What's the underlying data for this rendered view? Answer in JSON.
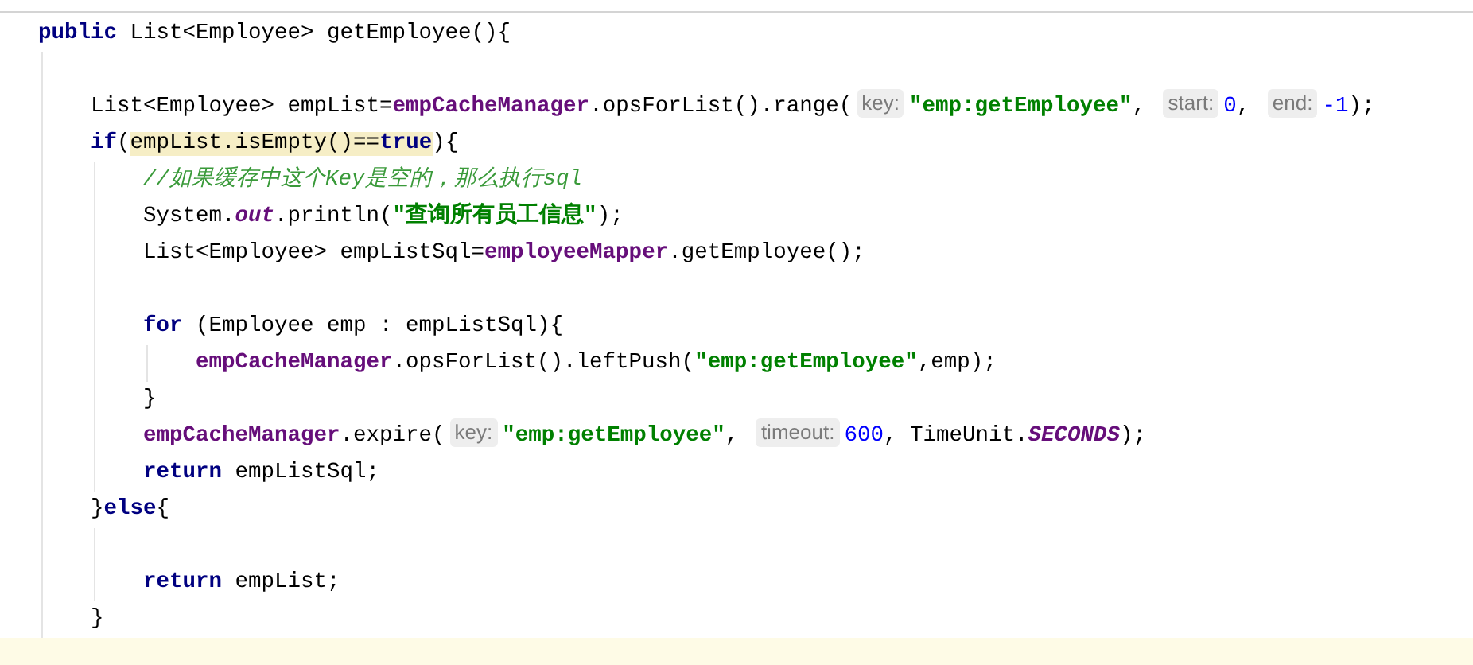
{
  "editor": {
    "lines": [
      {
        "current": false,
        "tokens": [
          {
            "kind": "keyword",
            "text": "public",
            "marked": false
          },
          {
            "kind": "plain",
            "text": " List<Employee> getEmployee(){",
            "marked": false
          }
        ],
        "children": [
          {
            "current": false
          },
          {
            "current": false,
            "tokens": [
              {
                "kind": "plain",
                "text": "List<Employee> empList=",
                "marked": false
              },
              {
                "kind": "field",
                "text": "empCacheManager",
                "marked": false
              },
              {
                "kind": "plain",
                "text": ".opsForList().range(",
                "marked": false
              },
              {
                "kind": "hint",
                "text": "key:",
                "marked": false
              },
              {
                "kind": "string",
                "text": "\"emp:getEmployee\"",
                "marked": false
              },
              {
                "kind": "plain",
                "text": ", ",
                "marked": false
              },
              {
                "kind": "hint",
                "text": "start:",
                "marked": false
              },
              {
                "kind": "number",
                "text": "0",
                "marked": false
              },
              {
                "kind": "plain",
                "text": ", ",
                "marked": false
              },
              {
                "kind": "hint",
                "text": "end:",
                "marked": false
              },
              {
                "kind": "number",
                "text": "-1",
                "marked": false
              },
              {
                "kind": "plain",
                "text": ");",
                "marked": false
              }
            ]
          },
          {
            "current": false,
            "tokens": [
              {
                "kind": "keyword",
                "text": "if",
                "marked": false
              },
              {
                "kind": "plain",
                "text": "(",
                "marked": false
              },
              {
                "kind": "plain",
                "text": "empList.isEmpty()==",
                "marked": true
              },
              {
                "kind": "keyword",
                "text": "true",
                "marked": true
              },
              {
                "kind": "plain",
                "text": "){",
                "marked": false
              }
            ],
            "children": [
              {
                "current": false,
                "tokens": [
                  {
                    "kind": "comment",
                    "text": "//如果缓存中这个Key是空的，那么执行sql",
                    "marked": false
                  }
                ]
              },
              {
                "current": false,
                "tokens": [
                  {
                    "kind": "plain",
                    "text": "System.",
                    "marked": false
                  },
                  {
                    "kind": "static",
                    "text": "out",
                    "marked": false
                  },
                  {
                    "kind": "plain",
                    "text": ".println(",
                    "marked": false
                  },
                  {
                    "kind": "string",
                    "text": "\"查询所有员工信息\"",
                    "marked": false
                  },
                  {
                    "kind": "plain",
                    "text": ");",
                    "marked": false
                  }
                ]
              },
              {
                "current": false,
                "tokens": [
                  {
                    "kind": "plain",
                    "text": "List<Employee> empListSql=",
                    "marked": false
                  },
                  {
                    "kind": "field",
                    "text": "employeeMapper",
                    "marked": false
                  },
                  {
                    "kind": "plain",
                    "text": ".getEmployee();",
                    "marked": false
                  }
                ]
              },
              {
                "current": false
              },
              {
                "current": false,
                "tokens": [
                  {
                    "kind": "keyword",
                    "text": "for",
                    "marked": false
                  },
                  {
                    "kind": "plain",
                    "text": " (Employee emp : empListSql){",
                    "marked": false
                  }
                ],
                "children": [
                  {
                    "current": false,
                    "tokens": [
                      {
                        "kind": "field",
                        "text": "empCacheManager",
                        "marked": false
                      },
                      {
                        "kind": "plain",
                        "text": ".opsForList().leftPush(",
                        "marked": false
                      },
                      {
                        "kind": "string",
                        "text": "\"emp:getEmployee\"",
                        "marked": false
                      },
                      {
                        "kind": "plain",
                        "text": ",emp);",
                        "marked": false
                      }
                    ]
                  }
                ]
              },
              {
                "current": false,
                "tokens": [
                  {
                    "kind": "plain",
                    "text": "}",
                    "marked": false
                  }
                ]
              },
              {
                "current": false,
                "tokens": [
                  {
                    "kind": "field",
                    "text": "empCacheManager",
                    "marked": false
                  },
                  {
                    "kind": "plain",
                    "text": ".expire(",
                    "marked": false
                  },
                  {
                    "kind": "hint",
                    "text": "key:",
                    "marked": false
                  },
                  {
                    "kind": "string",
                    "text": "\"emp:getEmployee\"",
                    "marked": false
                  },
                  {
                    "kind": "plain",
                    "text": ", ",
                    "marked": false
                  },
                  {
                    "kind": "hint",
                    "text": "timeout:",
                    "marked": false
                  },
                  {
                    "kind": "number",
                    "text": "600",
                    "marked": false
                  },
                  {
                    "kind": "plain",
                    "text": ", TimeUnit.",
                    "marked": false
                  },
                  {
                    "kind": "static",
                    "text": "SECONDS",
                    "marked": false
                  },
                  {
                    "kind": "plain",
                    "text": ");",
                    "marked": false
                  }
                ]
              },
              {
                "current": false,
                "tokens": [
                  {
                    "kind": "keyword",
                    "text": "return",
                    "marked": false
                  },
                  {
                    "kind": "plain",
                    "text": " empListSql;",
                    "marked": false
                  }
                ]
              }
            ]
          },
          {
            "current": false,
            "tokens": [
              {
                "kind": "plain",
                "text": "}",
                "marked": false
              },
              {
                "kind": "keyword",
                "text": "else",
                "marked": false
              },
              {
                "kind": "plain",
                "text": "{",
                "marked": false
              }
            ],
            "children": [
              {
                "current": false
              },
              {
                "current": false,
                "tokens": [
                  {
                    "kind": "keyword",
                    "text": "return",
                    "marked": false
                  },
                  {
                    "kind": "plain",
                    "text": " empList;",
                    "marked": false
                  }
                ]
              }
            ]
          },
          {
            "current": false,
            "tokens": [
              {
                "kind": "plain",
                "text": "}",
                "marked": false
              }
            ]
          },
          {
            "current": true
          }
        ]
      }
    ]
  }
}
